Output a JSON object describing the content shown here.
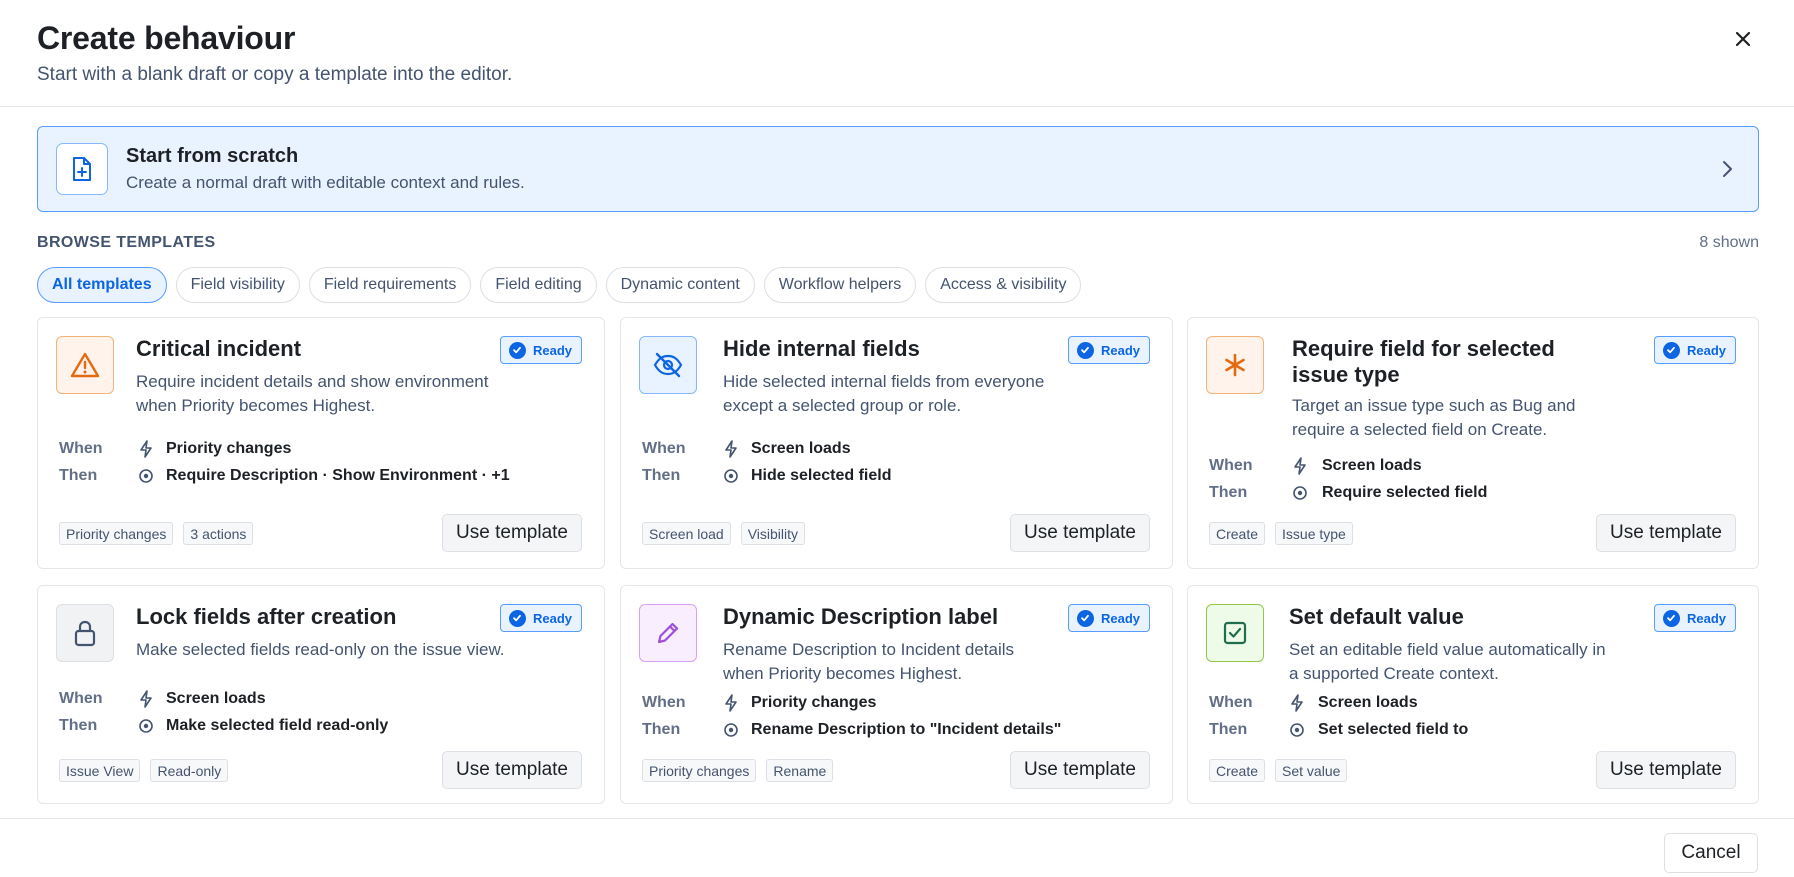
{
  "dialog": {
    "title": "Create behaviour",
    "subtitle": "Start with a blank draft or copy a template into the editor.",
    "close_icon": "close-icon"
  },
  "scratch": {
    "title": "Start from scratch",
    "description": "Create a normal draft with editable context and rules.",
    "icon": "file-plus-icon"
  },
  "browse": {
    "label": "BROWSE TEMPLATES",
    "count": "8 shown"
  },
  "filters": [
    {
      "label": "All templates",
      "active": true
    },
    {
      "label": "Field visibility",
      "active": false
    },
    {
      "label": "Field requirements",
      "active": false
    },
    {
      "label": "Field editing",
      "active": false
    },
    {
      "label": "Dynamic content",
      "active": false
    },
    {
      "label": "Workflow helpers",
      "active": false
    },
    {
      "label": "Access & visibility",
      "active": false
    }
  ],
  "labels": {
    "when": "When",
    "then": "Then",
    "use_template": "Use template",
    "ready": "Ready"
  },
  "templates": [
    {
      "title": "Critical incident",
      "description": "Require incident details and show environment when Priority becomes Highest.",
      "icon": "warning-icon",
      "accent": "#e56910",
      "status": "Ready",
      "when": "Priority changes",
      "then": "Require Description · Show Environment · +1",
      "tags": [
        "Priority changes",
        "3 actions"
      ]
    },
    {
      "title": "Hide internal fields",
      "description": "Hide selected internal fields from everyone except a selected group or role.",
      "icon": "eye-off-icon",
      "accent": "#0c66e4",
      "status": "Ready",
      "when": "Screen loads",
      "then": "Hide selected field",
      "tags": [
        "Screen load",
        "Visibility"
      ]
    },
    {
      "title": "Require field for selected issue type",
      "description": "Target an issue type such as Bug and require a selected field on Create.",
      "icon": "asterisk-icon",
      "accent": "#e56910",
      "status": "Ready",
      "when": "Screen loads",
      "then": "Require selected field",
      "tags": [
        "Create",
        "Issue type"
      ]
    },
    {
      "title": "Lock fields after creation",
      "description": "Make selected fields read-only on the issue view.",
      "icon": "lock-icon",
      "accent": "#44546f",
      "status": "Ready",
      "when": "Screen loads",
      "then": "Make selected field read-only",
      "tags": [
        "Issue View",
        "Read-only"
      ]
    },
    {
      "title": "Dynamic Description label",
      "description": "Rename Description to Incident details when Priority becomes Highest.",
      "icon": "pencil-icon",
      "accent": "#9f4fd8",
      "status": "Ready",
      "when": "Priority changes",
      "then": "Rename Description to \"Incident details\"",
      "tags": [
        "Priority changes",
        "Rename"
      ]
    },
    {
      "title": "Set default value",
      "description": "Set an editable field value automatically in a supported Create context.",
      "icon": "checkbox-icon",
      "accent": "#22a06b",
      "status": "Ready",
      "when": "Screen loads",
      "then": "Set selected field to",
      "tags": [
        "Create",
        "Set value"
      ]
    }
  ],
  "footer": {
    "cancel": "Cancel"
  }
}
